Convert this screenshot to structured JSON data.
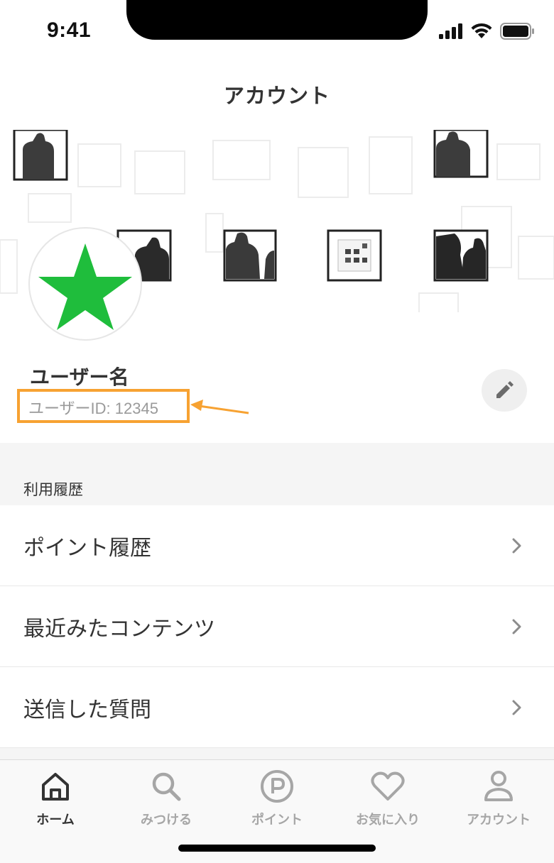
{
  "status": {
    "time": "9:41"
  },
  "nav": {
    "title": "アカウント"
  },
  "profile": {
    "name": "ユーザー名",
    "user_id": "ユーザーID: 12345",
    "avatar_icon": "star-icon",
    "avatar_color": "#1fbd3c"
  },
  "history_section": {
    "title": "利用履歴",
    "items": [
      {
        "label": "ポイント履歴"
      },
      {
        "label": "最近みたコンテンツ"
      },
      {
        "label": "送信した質問"
      }
    ]
  },
  "tabs": [
    {
      "label": "ホーム",
      "icon": "home-icon",
      "active": true
    },
    {
      "label": "みつける",
      "icon": "search-icon",
      "active": false
    },
    {
      "label": "ポイント",
      "icon": "point-icon",
      "active": false
    },
    {
      "label": "お気に入り",
      "icon": "heart-icon",
      "active": false
    },
    {
      "label": "アカウント",
      "icon": "person-icon",
      "active": false
    }
  ],
  "colors": {
    "highlight": "#f7a232",
    "tab_active": "#333333",
    "tab_inactive": "#a6a6a6"
  }
}
